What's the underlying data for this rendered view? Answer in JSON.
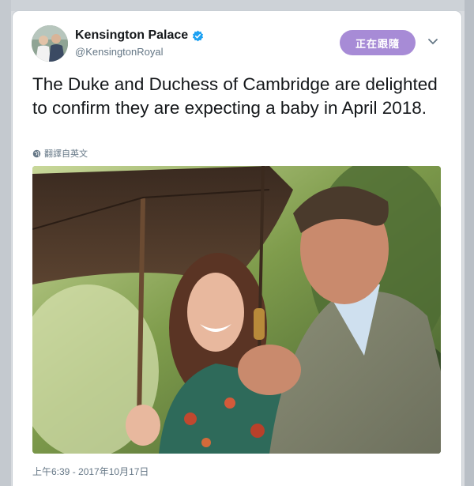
{
  "account": {
    "display_name": "Kensington Palace",
    "handle": "@KensingtonRoyal",
    "verified_icon": "verified-badge-icon",
    "avatar_icon": "avatar"
  },
  "follow_button": {
    "label": "正在跟隨",
    "color": "#a78bd6"
  },
  "tweet": {
    "text": "The Duke and Duchess of Cambridge are delighted to confirm they are expecting a baby in April 2018.",
    "translate_label": "翻譯自英文",
    "timestamp": "上午6:39 - 2017年10月17日"
  },
  "colors": {
    "verified": "#1da1f2",
    "text": "#14171a",
    "muted": "#657786"
  }
}
